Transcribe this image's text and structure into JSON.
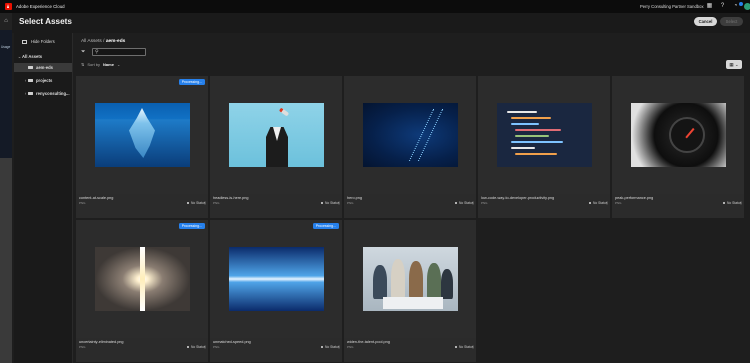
{
  "topbar": {
    "app_title": "Adobe Experience Cloud",
    "org_name": "Perry Consulting Partner Sandbox",
    "icons": [
      "apps-grid-icon",
      "help-icon",
      "bell-icon",
      "avatar"
    ]
  },
  "left_rail": {
    "home_icon": "home-icon",
    "tag": "Usage"
  },
  "modal": {
    "title": "Select Assets",
    "cancel_label": "Cancel",
    "select_label": "Select"
  },
  "sidebar": {
    "hide_folders_label": "Hide Folders",
    "tree": [
      {
        "label": "All Assets",
        "level": 0,
        "expanded": true
      },
      {
        "label": "aem-eds",
        "level": 1,
        "selected": true
      },
      {
        "label": "projects",
        "level": 1
      },
      {
        "label": "renyconsulting...",
        "level": 1
      }
    ]
  },
  "breadcrumb": {
    "root": "All Assets",
    "separator": "/",
    "current": "aem-eds"
  },
  "search": {
    "placeholder": "",
    "value": ""
  },
  "sort": {
    "label": "Sort by",
    "value": "Name"
  },
  "view_toggle_icon": "grid-view-icon",
  "assets": [
    {
      "name": "content-at-scale.png",
      "type": "PNG",
      "status": "No Status",
      "badge": "Processing..."
    },
    {
      "name": "headless-is-here.png",
      "type": "PNG",
      "status": "No Status",
      "badge": ""
    },
    {
      "name": "hero.png",
      "type": "PNG",
      "status": "No Status",
      "badge": ""
    },
    {
      "name": "low-code-way-to-developer-productivity.png",
      "type": "PNG",
      "status": "No Status",
      "badge": ""
    },
    {
      "name": "peak-performance.png",
      "type": "PNG",
      "status": "No Status",
      "badge": ""
    },
    {
      "name": "uncertainty-eliminated.png",
      "type": "PNG",
      "status": "No Status",
      "badge": "Processing..."
    },
    {
      "name": "unmatched-speed.png",
      "type": "PNG",
      "status": "No Status",
      "badge": "Processing..."
    },
    {
      "name": "widen-the-talent-pool.png",
      "type": "PNG",
      "status": "No Status",
      "badge": ""
    }
  ]
}
